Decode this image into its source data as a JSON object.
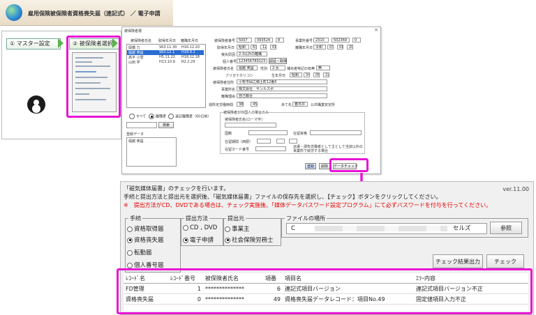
{
  "header": {
    "title": "雇用保険被保険者資格喪失届（連記式） ／ 電子申請"
  },
  "steps": {
    "master": "① マスター設定",
    "select": "② 被保険者選択"
  },
  "dialog": {
    "title": "被保険者選",
    "list_headers": [
      "被保険者氏名",
      "取得年月日",
      "離職年月日"
    ],
    "list_rows": [
      [
        "岡橋 力",
        "S63.11.30",
        "H16.12.20"
      ],
      [
        "堀越 英昌",
        "S63.12.1",
        "H18.9.1"
      ],
      [
        "高平 小雪",
        "H5.11.22",
        "H18.12.18"
      ],
      [
        "山田 学",
        "H13.10.9",
        "R2.2.29"
      ]
    ],
    "radios": [
      "すべて",
      "離職者",
      "退記離職者（60日前）"
    ],
    "search_button": "検索",
    "data_label": "登録データ",
    "data_item": "堀越 英昌",
    "form_labels": {
      "insured_no": "被保険者番号",
      "office_no": "事業所番号",
      "acquired": "取得年月日",
      "left": "離職年月日",
      "reason": "喪失原因",
      "indiv_no": "個人番号",
      "name": "被保険者氏名",
      "sex": "性別",
      "kana": "フリガナ",
      "birth": "生年月日",
      "address": "被保険者住所",
      "office_name": "事業所名",
      "retire_reason": "離職理由",
      "hours": "週所定労働時間",
      "dest": "あて先",
      "foreign_section": "被保険者が外国人の場合のみ",
      "foreign_name": "被保険者氏名(ローマ字)",
      "nationality": "国籍",
      "status": "在留資格",
      "period": "在留期間（西暦）",
      "card": "在留カード番号",
      "dispatch": "派遣・請負労働者として主として当該以外の事業所で就労する場合"
    },
    "form_values": {
      "insured_no": [
        "5007",
        "093524",
        "8"
      ],
      "office_no": [
        "2310",
        "502369",
        "0"
      ],
      "acq_era": "昭和",
      "acq_y": "63",
      "acq_m": "12",
      "acq_d": "01",
      "left_era": "令和",
      "left_y": "03",
      "left_m": "01",
      "left_d": "20",
      "reason": "2:3以外の離職",
      "indiv_no": "123456789123",
      "indiv_btn": "認証・取得",
      "name": "堀越 英昌",
      "sex": "2:女",
      "mention": "補充者特記の有無",
      "mention_val": "無",
      "kana": "ホリコシ",
      "birth_era": "昭和",
      "birth_y": "34",
      "birth_m": "05",
      "birth_d": "22",
      "address": "小牧市岡之郷土町12番5",
      "office_name": "株式会社　サンルスポ",
      "retire_reason": "自己都合",
      "hours_h": "38",
      "hours_m": "45",
      "dest": "春日井",
      "dest_suffix": "公共職業安定所"
    },
    "buttons": {
      "register": "登録",
      "delete": "削除",
      "datacheck": "データチェック"
    }
  },
  "check": {
    "line1": "「磁気媒体届書」のチェックを行います。",
    "line2": "手続と提出方法と提出元を選択後、「磁気媒体届書」ファイルの保存先を選択し、【チェック】ボタンをクリックしてください。",
    "line3": "※　提出方法がCD、DVDである場合は、チェック実施後、「媒体データパスワード設定プログラム」にて必ずパスワードを付与を行ってください。",
    "version": "ver.11.00",
    "procedure": {
      "title": "手続",
      "options": [
        "資格取得届",
        "資格喪失届",
        "転勤届",
        "個人番号届"
      ],
      "selected": 1
    },
    "method": {
      "title": "提出方法",
      "options": [
        "CD , DVD",
        "電子申請"
      ],
      "selected": 1
    },
    "source": {
      "title": "提出元",
      "options": [
        "事業主",
        "社会保険労務士"
      ],
      "selected": 1
    },
    "file": {
      "title": "ファイルの場所",
      "path_start": "C",
      "path_end": "セルズ",
      "browse": "参照"
    },
    "result_button": "チェック結果出力",
    "check_button": "チェック",
    "table": {
      "headers": [
        "ﾚｺｰﾄﾞ名",
        "ﾚｺｰﾄﾞ番号",
        "被保険者氏名",
        "項番",
        "項目名",
        "ｴﾗｰ内容"
      ],
      "rows": [
        [
          "FD管理",
          "1",
          "**************",
          "6",
          "連記式項目バージョン",
          "連記式項目バージョン不正"
        ],
        [
          "資格喪失届",
          "0",
          "**************",
          "49",
          "資格喪失届データレコード：項目No.49",
          "固定値項目入力不正"
        ]
      ]
    }
  }
}
